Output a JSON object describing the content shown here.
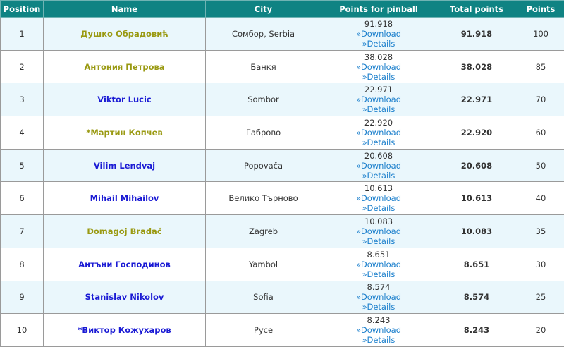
{
  "headers": [
    "Position",
    "Name",
    "City",
    "Points for pinball",
    "Total points",
    "Points"
  ],
  "colors": {
    "header_bg": "#0f8383",
    "name_olive": "#9a9a13",
    "name_blue": "#1a1ad4",
    "link": "#1b7fcc"
  },
  "link_labels": {
    "download": "»Download",
    "details": "»Details"
  },
  "rows": [
    {
      "position": "1",
      "name": "Душко Обрадовић",
      "name_color": "olive",
      "city": "Сомбор, Serbia",
      "pinball_points": "91.918",
      "total_points": "91.918",
      "points": "100"
    },
    {
      "position": "2",
      "name": "Антония Петрова",
      "name_color": "olive",
      "city": "Банкя",
      "pinball_points": "38.028",
      "total_points": "38.028",
      "points": "85"
    },
    {
      "position": "3",
      "name": "Viktor Lucic",
      "name_color": "blue",
      "city": "Sombor",
      "pinball_points": "22.971",
      "total_points": "22.971",
      "points": "70"
    },
    {
      "position": "4",
      "name": "*Мартин Копчев",
      "name_color": "olive",
      "city": "Габрово",
      "pinball_points": "22.920",
      "total_points": "22.920",
      "points": "60"
    },
    {
      "position": "5",
      "name": "Vilim Lendvaj",
      "name_color": "blue",
      "city": "Popovača",
      "pinball_points": "20.608",
      "total_points": "20.608",
      "points": "50"
    },
    {
      "position": "6",
      "name": "Mihail Mihailov",
      "name_color": "blue",
      "city": "Велико Търново",
      "pinball_points": "10.613",
      "total_points": "10.613",
      "points": "40"
    },
    {
      "position": "7",
      "name": "Domagoj Bradač",
      "name_color": "olive",
      "city": "Zagreb",
      "pinball_points": "10.083",
      "total_points": "10.083",
      "points": "35"
    },
    {
      "position": "8",
      "name": "Антъни Господинов",
      "name_color": "blue",
      "city": "Yambol",
      "pinball_points": "8.651",
      "total_points": "8.651",
      "points": "30"
    },
    {
      "position": "9",
      "name": "Stanislav Nikolov",
      "name_color": "blue",
      "city": "Sofia",
      "pinball_points": "8.574",
      "total_points": "8.574",
      "points": "25"
    },
    {
      "position": "10",
      "name": "*Виктор Кожухаров",
      "name_color": "blue",
      "city": "Русе",
      "pinball_points": "8.243",
      "total_points": "8.243",
      "points": "20"
    }
  ]
}
